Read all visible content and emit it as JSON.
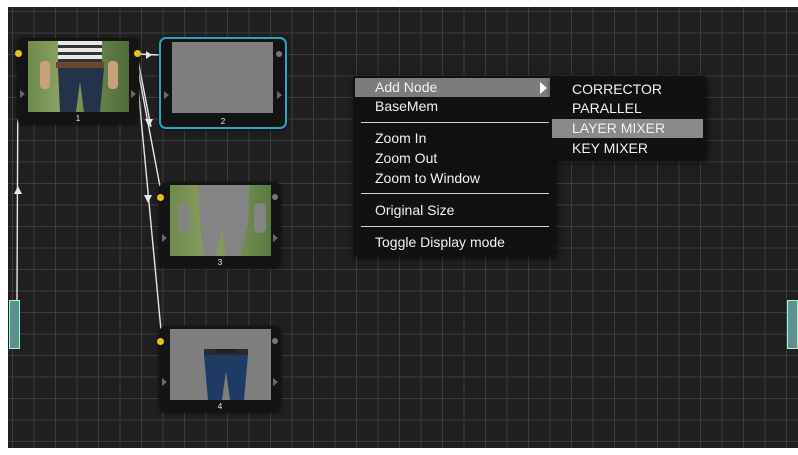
{
  "nodes": [
    {
      "label": "1",
      "selected": false
    },
    {
      "label": "2",
      "selected": true
    },
    {
      "label": "3",
      "selected": false
    },
    {
      "label": "4",
      "selected": false
    }
  ],
  "context_menu": {
    "items": [
      "Add Node",
      "BaseMem",
      "Zoom In",
      "Zoom Out",
      "Zoom to Window",
      "Original Size",
      "Toggle Display mode"
    ],
    "highlighted": "Add Node"
  },
  "submenu": {
    "items": [
      "CORRECTOR",
      "PARALLEL",
      "LAYER MIXER",
      "KEY MIXER"
    ],
    "highlighted": "LAYER MIXER"
  },
  "colors": {
    "canvas_bg": "#1f1f1f",
    "grid": "#3c3c3c",
    "selection_border": "#28a6c2",
    "port_dot": "#e9c21a"
  }
}
